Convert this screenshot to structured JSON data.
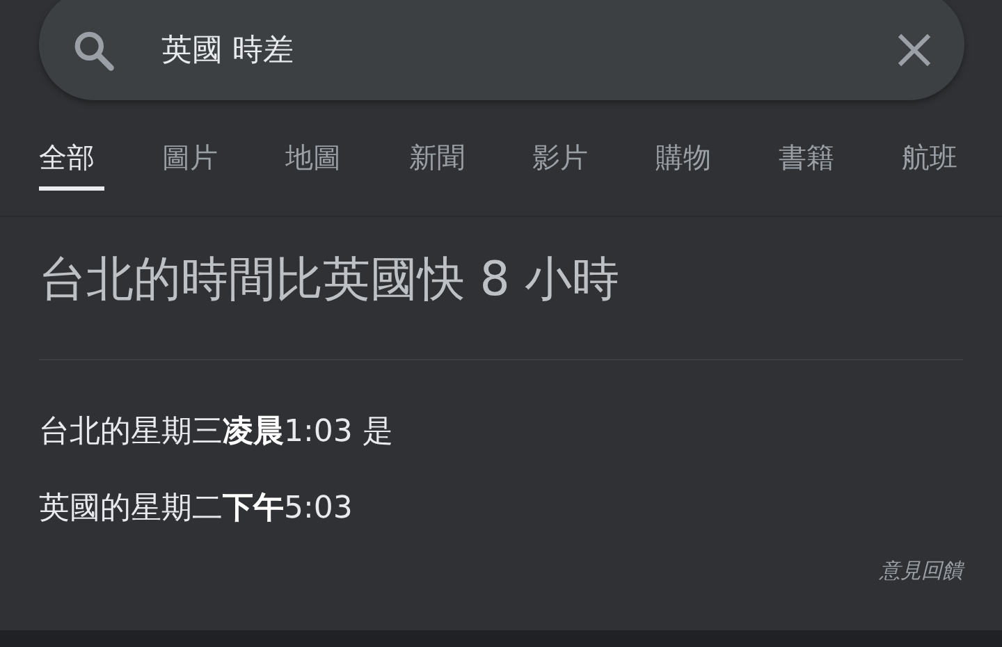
{
  "search": {
    "value": "英國 時差"
  },
  "tabs": [
    {
      "label": "全部",
      "selected": true
    },
    {
      "label": "圖片",
      "selected": false
    },
    {
      "label": "地圖",
      "selected": false
    },
    {
      "label": "新聞",
      "selected": false
    },
    {
      "label": "影片",
      "selected": false
    },
    {
      "label": "購物",
      "selected": false
    },
    {
      "label": "書籍",
      "selected": false
    },
    {
      "label": "航班",
      "selected": false
    }
  ],
  "answer": {
    "headline": "台北的時間比英國快 8 小時",
    "lines": [
      "台北的星期三**凌晨**1:03 是",
      "英國的星期二**下午**5:03"
    ],
    "feedback": "意見回饋"
  }
}
